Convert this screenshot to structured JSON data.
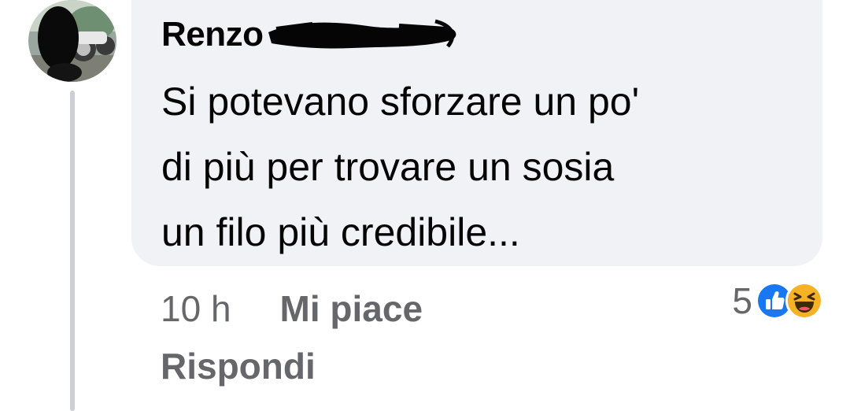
{
  "comment": {
    "author": "Renzo",
    "text": "Si potevano sforzare un po'\ndi più per trovare un sosia\nun filo più credibile...",
    "timestamp": "10 h",
    "like_label": "Mi piace",
    "reply_label": "Rispondi",
    "reaction_count": "5",
    "reactions": [
      "like-icon",
      "haha-icon"
    ]
  },
  "colors": {
    "bubble": "#f0f2f5",
    "text": "#050505",
    "secondary": "#65676b",
    "like_blue": "#1877f2",
    "haha_yellow": "#f7b125",
    "thread_line": "#ccd0d5"
  }
}
